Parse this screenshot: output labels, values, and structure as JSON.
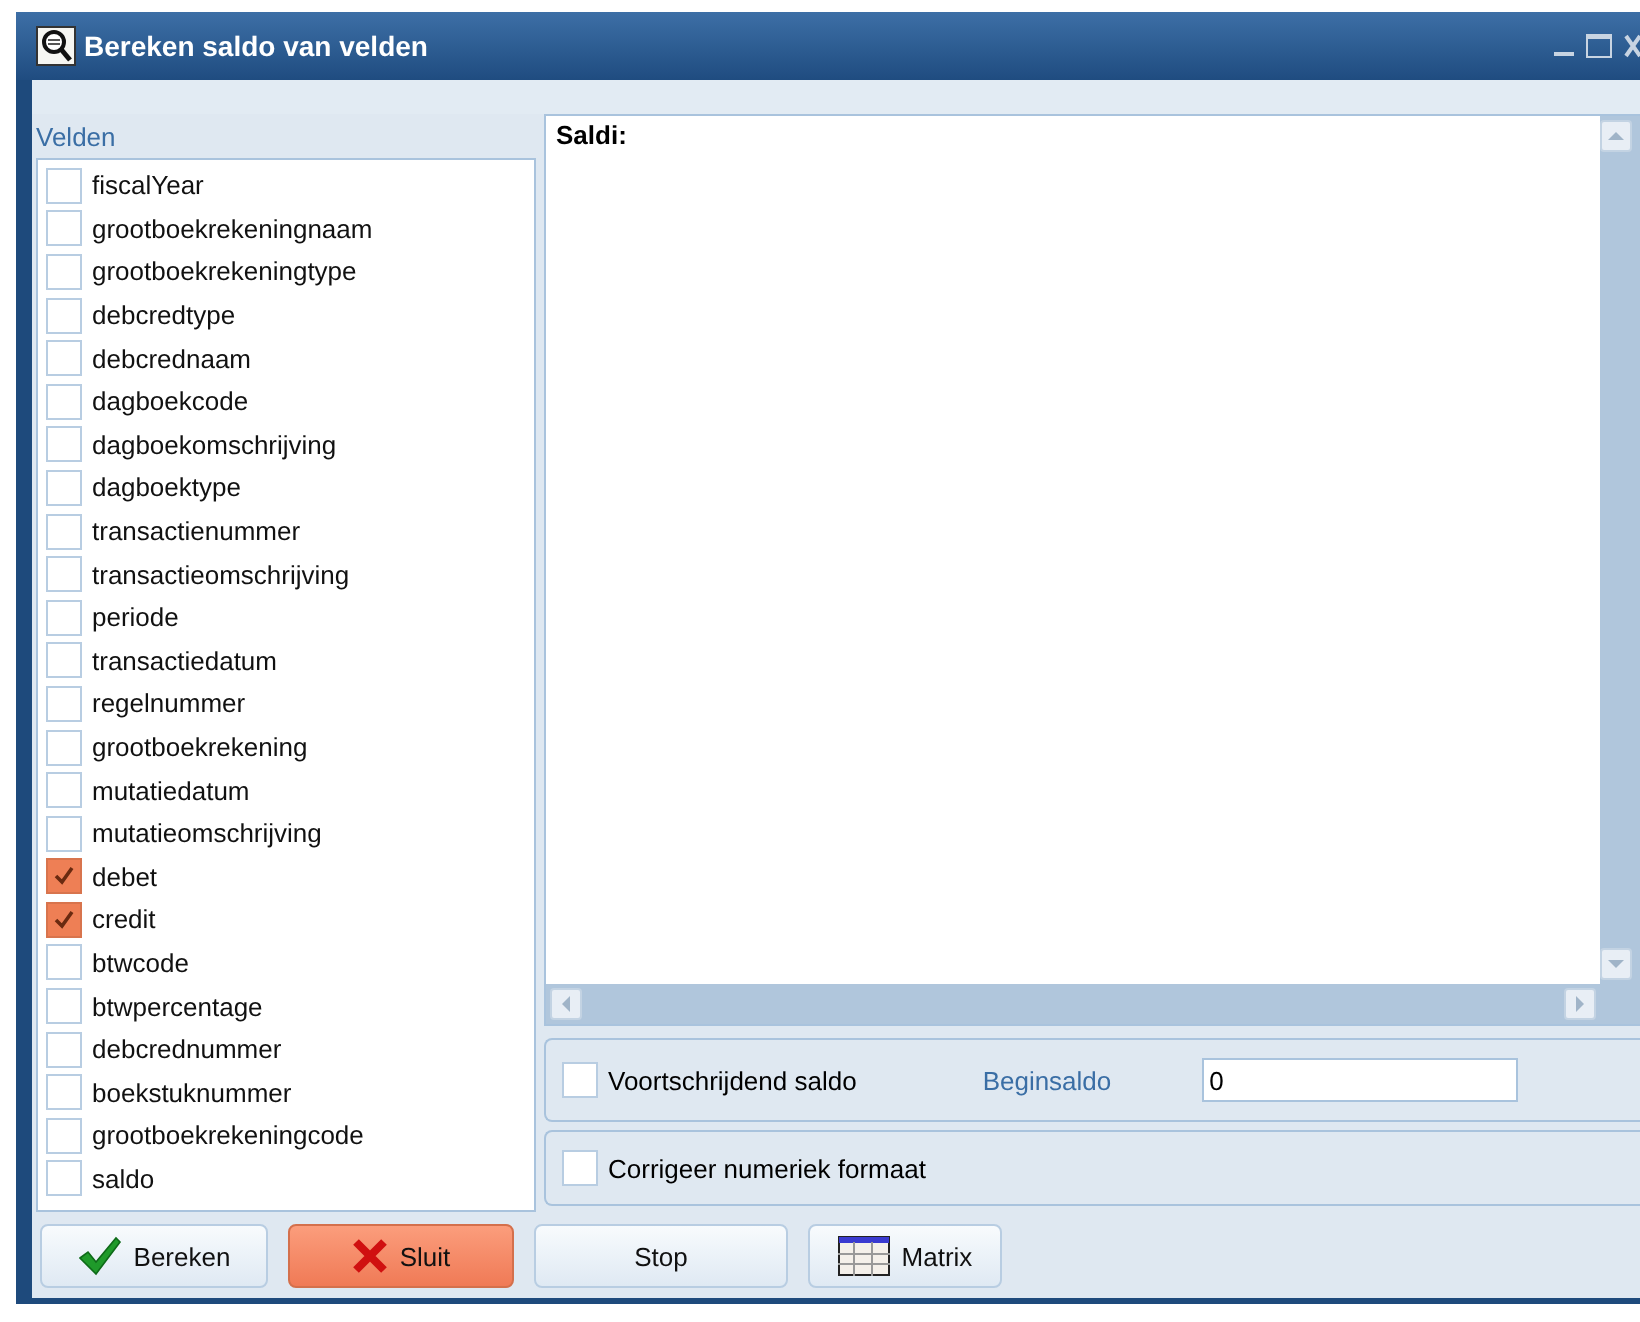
{
  "window": {
    "title": "Bereken saldo van velden"
  },
  "fields": {
    "label": "Velden",
    "items": [
      {
        "label": "fiscalYear",
        "checked": false
      },
      {
        "label": "grootboekrekeningnaam",
        "checked": false
      },
      {
        "label": "grootboekrekeningtype",
        "checked": false
      },
      {
        "label": "debcredtype",
        "checked": false
      },
      {
        "label": "debcrednaam",
        "checked": false
      },
      {
        "label": "dagboekcode",
        "checked": false
      },
      {
        "label": "dagboekomschrijving",
        "checked": false
      },
      {
        "label": "dagboektype",
        "checked": false
      },
      {
        "label": "transactienummer",
        "checked": false
      },
      {
        "label": "transactieomschrijving",
        "checked": false
      },
      {
        "label": "periode",
        "checked": false
      },
      {
        "label": "transactiedatum",
        "checked": false
      },
      {
        "label": "regelnummer",
        "checked": false
      },
      {
        "label": "grootboekrekening",
        "checked": false
      },
      {
        "label": "mutatiedatum",
        "checked": false
      },
      {
        "label": "mutatieomschrijving",
        "checked": false
      },
      {
        "label": "debet",
        "checked": true
      },
      {
        "label": "credit",
        "checked": true
      },
      {
        "label": "btwcode",
        "checked": false
      },
      {
        "label": "btwpercentage",
        "checked": false
      },
      {
        "label": "debcrednummer",
        "checked": false
      },
      {
        "label": "boekstuknummer",
        "checked": false
      },
      {
        "label": "grootboekrekeningcode",
        "checked": false
      },
      {
        "label": "saldo",
        "checked": false
      }
    ]
  },
  "result": {
    "label": "Saldi:"
  },
  "options": [
    {
      "kind": "running",
      "label": "Voortschrijdend saldo",
      "checked": false,
      "field_label": "Beginsaldo",
      "value": "0"
    },
    {
      "kind": "plain",
      "label": "Corrigeer numeriek formaat",
      "checked": false
    }
  ],
  "buttons": [
    {
      "kind": "ok",
      "label": "Bereken"
    },
    {
      "kind": "close",
      "label": "Sluit"
    },
    {
      "kind": "plain",
      "label": "Stop"
    },
    {
      "kind": "matrix",
      "label": "Matrix"
    }
  ]
}
